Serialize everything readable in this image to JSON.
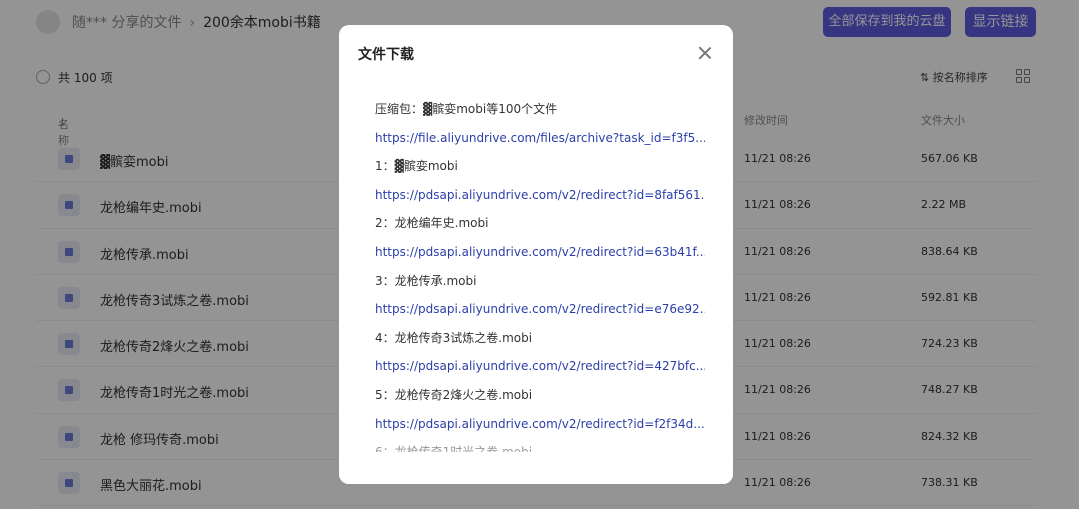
{
  "header": {
    "sharer": "随*** 分享的文件",
    "separator": "›",
    "folder": "200余本mobi书籍",
    "save_button": "全部保存到我的云盘",
    "show_link_button": "显示链接"
  },
  "toolbar": {
    "count": "共 100 项",
    "sort_label": "按名称排序"
  },
  "columns": {
    "name": "名称",
    "modified": "修改时间",
    "size": "文件大小"
  },
  "files": [
    {
      "name": "▓髌娈mobi",
      "modified": "11/21 08:26",
      "size": "567.06 KB"
    },
    {
      "name": "龙枪编年史.mobi",
      "modified": "11/21 08:26",
      "size": "2.22 MB"
    },
    {
      "name": "龙枪传承.mobi",
      "modified": "11/21 08:26",
      "size": "838.64 KB"
    },
    {
      "name": "龙枪传奇3试炼之卷.mobi",
      "modified": "11/21 08:26",
      "size": "592.81 KB"
    },
    {
      "name": "龙枪传奇2烽火之卷.mobi",
      "modified": "11/21 08:26",
      "size": "724.23 KB"
    },
    {
      "name": "龙枪传奇1时光之卷.mobi",
      "modified": "11/21 08:26",
      "size": "748.27 KB"
    },
    {
      "name": "龙枪 修玛传奇.mobi",
      "modified": "11/21 08:26",
      "size": "824.32 KB"
    },
    {
      "name": "黑色大丽花.mobi",
      "modified": "11/21 08:26",
      "size": "738.31 KB"
    }
  ],
  "modal": {
    "title": "文件下载",
    "lines": [
      {
        "type": "label",
        "text": "压缩包：▓髌娈mobi等100个文件"
      },
      {
        "type": "link",
        "text": "https://file.aliyundrive.com/files/archive?task_id=f3f5..."
      },
      {
        "type": "label",
        "text": "1：▓髌娈mobi"
      },
      {
        "type": "link",
        "text": "https://pdsapi.aliyundrive.com/v2/redirect?id=8faf561..."
      },
      {
        "type": "label",
        "text": "2：龙枪编年史.mobi"
      },
      {
        "type": "link",
        "text": "https://pdsapi.aliyundrive.com/v2/redirect?id=63b41f..."
      },
      {
        "type": "label",
        "text": "3：龙枪传承.mobi"
      },
      {
        "type": "link",
        "text": "https://pdsapi.aliyundrive.com/v2/redirect?id=e76e92..."
      },
      {
        "type": "label",
        "text": "4：龙枪传奇3试炼之卷.mobi"
      },
      {
        "type": "link",
        "text": "https://pdsapi.aliyundrive.com/v2/redirect?id=427bfc..."
      },
      {
        "type": "label",
        "text": "5：龙枪传奇2烽火之卷.mobi"
      },
      {
        "type": "link",
        "text": "https://pdsapi.aliyundrive.com/v2/redirect?id=f2f34d..."
      },
      {
        "type": "label",
        "text": "6：龙枪传奇1时光之卷.mobi"
      }
    ]
  }
}
